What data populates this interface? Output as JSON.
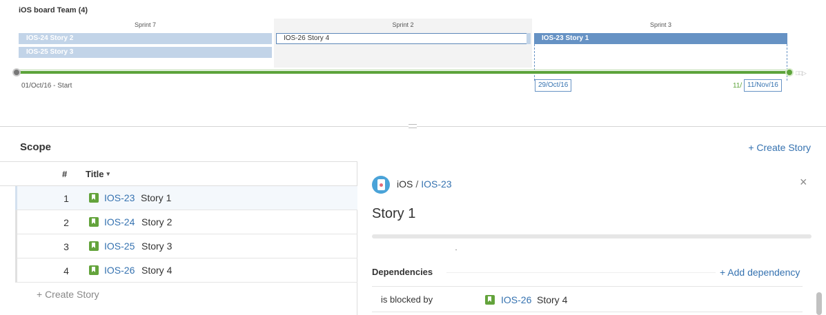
{
  "timeline": {
    "team_title": "iOS board Team (4)",
    "sprints": [
      {
        "label": "Sprint 7"
      },
      {
        "label": "Sprint 2"
      },
      {
        "label": "Sprint 3"
      }
    ],
    "bars": {
      "ios24": "IOS-24 Story 2",
      "ios25": "IOS-25 Story 3",
      "ios26": "IOS-26 Story 4",
      "ios23": "IOS-23 Story 1"
    },
    "start_date": "01/Oct/16 - Start",
    "mid_date": "29/Oct/16",
    "end_date_partial": "11/",
    "end_date": "11/Nov/16",
    "track_tail": "□□▷"
  },
  "scope": {
    "title": "Scope",
    "create_story_label": "+ Create Story",
    "columns": {
      "num": "#",
      "title": "Title",
      "sort_icon": "▾"
    },
    "rows": [
      {
        "num": "1",
        "key": "IOS-23",
        "name": "Story 1"
      },
      {
        "num": "2",
        "key": "IOS-24",
        "name": "Story 2"
      },
      {
        "num": "3",
        "key": "IOS-25",
        "name": "Story 3"
      },
      {
        "num": "4",
        "key": "IOS-26",
        "name": "Story 4"
      }
    ],
    "create_story_bottom": "+ Create Story"
  },
  "detail": {
    "project": "iOS",
    "separator": "/",
    "issue_key": "IOS-23",
    "title": "Story 1",
    "close_icon": "×",
    "dependencies_title": "Dependencies",
    "add_dependency": "+ Add dependency",
    "dependency": {
      "relation": "is blocked by",
      "key": "IOS-26",
      "name": "Story 4"
    }
  },
  "colors": {
    "link": "#3572b0",
    "story_green": "#63a33b",
    "bar_light": "#c2d4e8",
    "bar_dark": "#6692c4",
    "track_green": "#5ca33a"
  }
}
